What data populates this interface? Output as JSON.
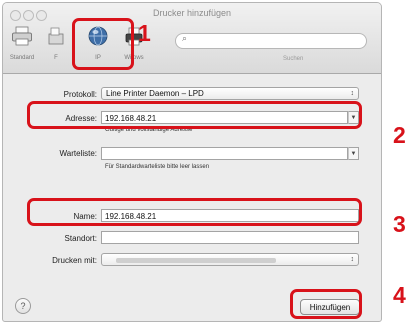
{
  "window": {
    "title": "Drucker hinzufügen"
  },
  "toolbar": {
    "standard_label": "Standard",
    "fax_label": "F",
    "ip_label": "IP",
    "windows_label": "Wi     ows",
    "search_placeholder": "",
    "search_label": "Suchen"
  },
  "form": {
    "protokoll_label": "Protokoll:",
    "protokoll_value": "Line Printer Daemon – LPD",
    "adresse_label": "Adresse:",
    "adresse_value": "192.168.48.21",
    "adresse_hint": "Gültige und vollständige Adresse",
    "warteliste_label": "Warteliste:",
    "warteliste_value": "",
    "warteliste_hint": "Für Standardwarteliste bitte leer lassen",
    "name_label": "Name:",
    "name_value": "192.168.48.21",
    "standort_label": "Standort:",
    "standort_value": "",
    "drucken_mit_label": "Drucken mit:"
  },
  "buttons": {
    "add_label": "Hinzufügen",
    "help_glyph": "?"
  },
  "steps": {
    "one": "1",
    "two": "2",
    "three": "3",
    "four": "4"
  },
  "colors": {
    "callout": "#d8121a"
  },
  "icons": [
    "printer-icon",
    "fax-icon",
    "ip-globe-icon",
    "windows-icon",
    "search-icon",
    "help-icon",
    "chevron-down-icon"
  ]
}
